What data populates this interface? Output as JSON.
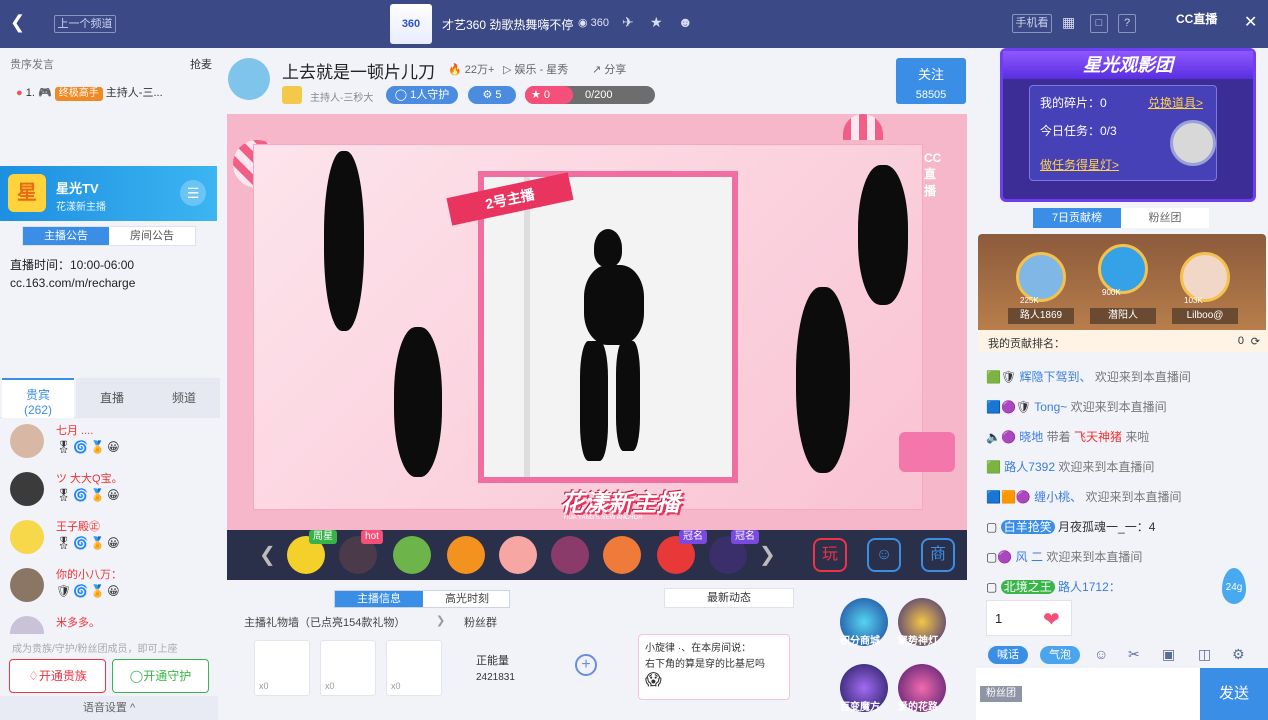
{
  "topbar": {
    "back_icon": "chevron-left-icon",
    "prev_channel": "上一个频道",
    "room_title": "才艺360 劲歌热舞嗨不停",
    "count": "360",
    "mobile_btn": "手机看",
    "logo_text": "CC直播"
  },
  "left": {
    "nobility_text": "贵序发言",
    "grab_text": "抢麦",
    "rank_no": "1.",
    "rank_badge": "终极高手",
    "rank_name": "主持人-三...",
    "card_avatar": "星",
    "card_name": "星光TV",
    "card_sub": "花漾新主播",
    "tab_notice": "主播公告",
    "tab_room": "房间公告",
    "notice_time": "直播时间：10:00-06:00",
    "notice_url": "cc.163.com/m/recharge",
    "aud_tabs": {
      "vip": "贵宾",
      "vip_count": "(262)",
      "live": "直播",
      "channel": "频道"
    },
    "users": [
      {
        "name": "七月 ...."
      },
      {
        "name": "ツ 大大Q宝。"
      },
      {
        "name": "王子殿㊣"
      },
      {
        "name": "你的小八万："
      },
      {
        "name": "米多多。"
      }
    ],
    "footer_text": "成为贵族/守护/粉丝团成员，即可上座",
    "btn_noble": "开通贵族",
    "btn_guard": "开通守护",
    "voice_settings": "语音设置 ^"
  },
  "center": {
    "title": "上去就是一顿片儿刀",
    "hot": "22万+",
    "category": "娱乐 - 星秀",
    "share": "分享",
    "host": "主持人-三秒大",
    "guards": "1人守护",
    "fans": "5",
    "gift_count": "0",
    "progress": "0/200",
    "progress_value": 0.0,
    "follow_label": "关注",
    "follow_count": "58505",
    "stage_banner": "2号主播",
    "stage_logo": "CC直播",
    "stage_brand": "花漾新主播",
    "stage_brand_sub": "HUA YANG'S NEW ANCHOR",
    "gift_badges": {
      "zhouxing": "周星",
      "hot": "hot",
      "guanming1": "冠名",
      "guanming2": "冠名"
    },
    "tab_info": "主播信息",
    "tab_highlight": "高光时刻",
    "gift_wall": "主播礼物墙（已点亮154款礼物）",
    "fans_group": "粉丝群",
    "energy_label": "正能量",
    "energy_value": "2421831",
    "news_title": "最新动态",
    "news_text1": "小旋律 ·、在本房间说：",
    "news_text2": "右下角的算是穿的比基尼吗",
    "badge_points": "积分商城",
    "badge_lamp": "聚势神灯",
    "badge_magic": "百变魔方",
    "badge_love": "爱的花路",
    "gw_counts": [
      "x0",
      "x0",
      "x0"
    ]
  },
  "right": {
    "star_title": "星光观影团",
    "fragments_label": "我的碎片：0",
    "exchange_link": "兑换道具>",
    "task_label": "今日任务：0/3",
    "task_link": "做任务得星灯>",
    "tab_weekly": "7日贡献榜",
    "tab_fans": "粉丝团",
    "rank_names": [
      "路人1869",
      "潜阳人",
      "Lilboo@"
    ],
    "rank_vals": [
      "225K",
      "900K",
      "103K"
    ],
    "myrank_label": "我的贡献排名：",
    "myrank_val": "0",
    "chats": [
      {
        "name": "辉隐下驾到、",
        "text": "欢迎来到本直播间"
      },
      {
        "name": "Tong~",
        "text": "欢迎来到本直播间"
      },
      {
        "name": "晓地",
        "text": "带着",
        "extra": "飞天神猪",
        "tail": "来啦"
      },
      {
        "name": "路人7392",
        "text": "欢迎来到本直播间"
      },
      {
        "name": "缠小桃、",
        "text": "欢迎来到本直播间"
      },
      {
        "name": "白羊抢笑",
        "text": "月夜孤魂一_一：4"
      },
      {
        "name": "风 二",
        "text": "欢迎来到本直播间"
      },
      {
        "name": "北境之王",
        "text": "路人1712："
      }
    ],
    "input_qty": "1",
    "coin": "24g",
    "btn_shout": "喊话",
    "btn_bubble": "气泡",
    "fan_badge": "粉丝团",
    "send": "发送"
  }
}
